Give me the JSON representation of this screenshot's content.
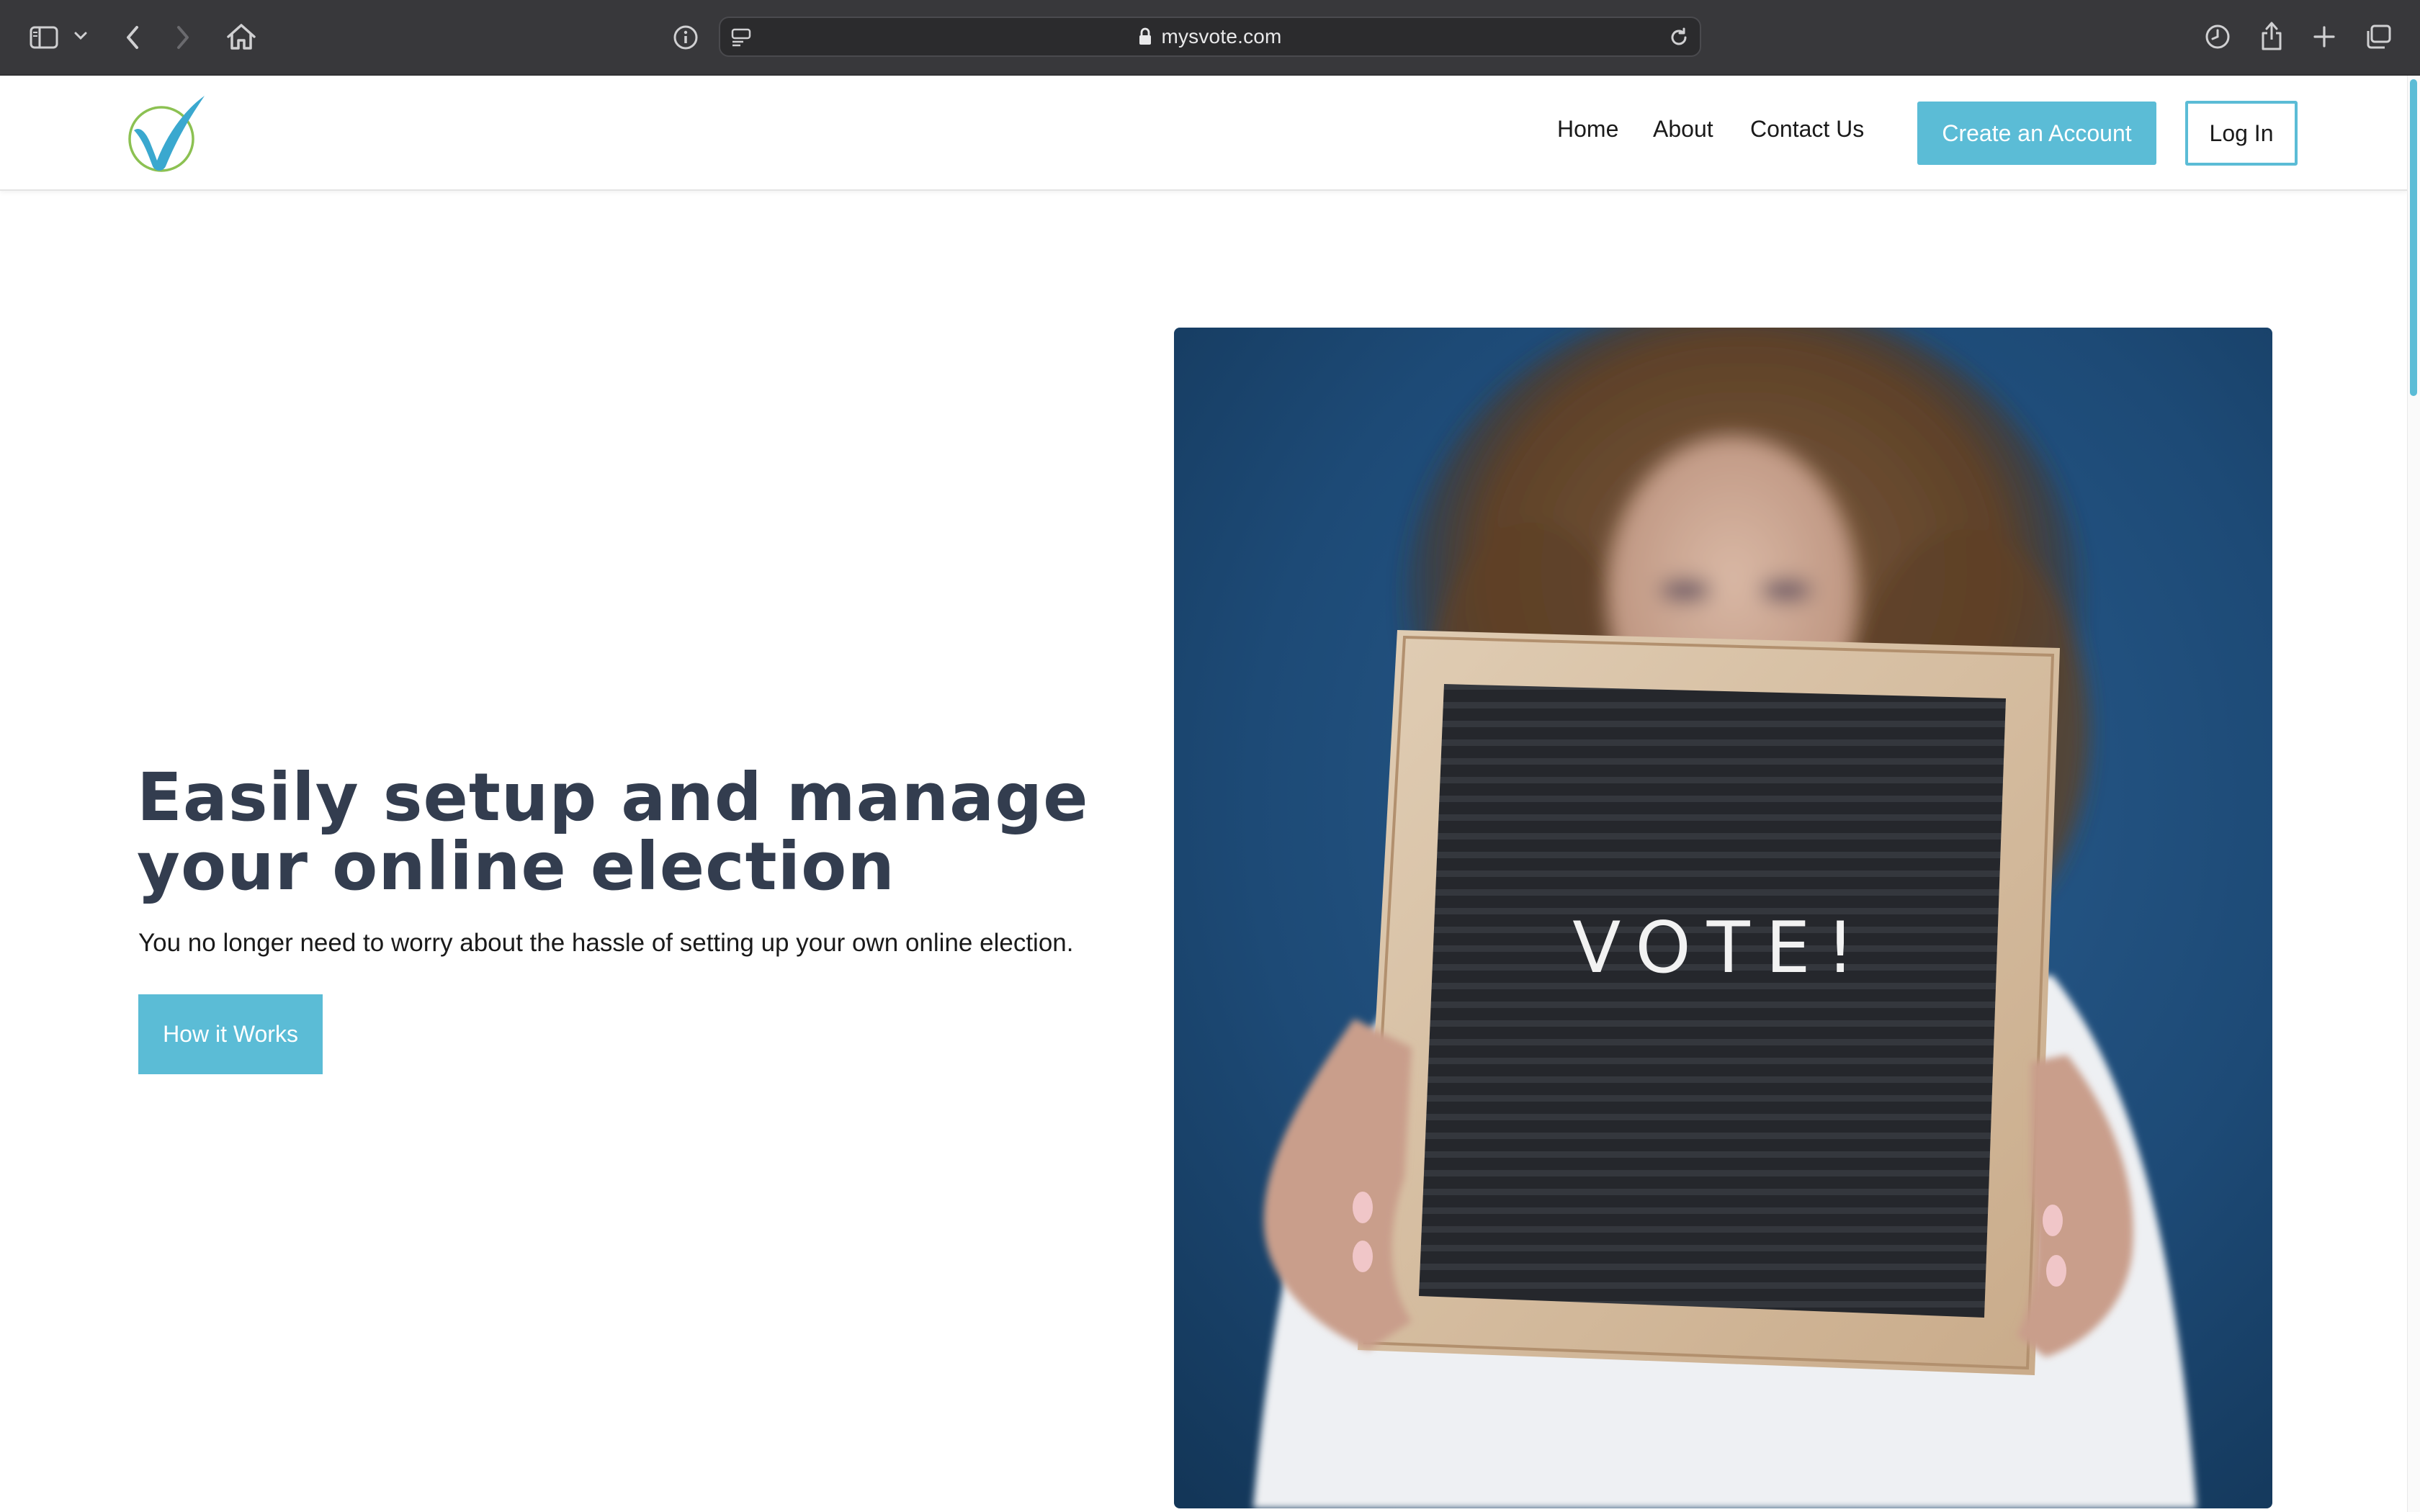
{
  "browser": {
    "url": "mysvote.com"
  },
  "nav": {
    "links": [
      "Home",
      "About",
      "Contact Us"
    ],
    "create_label": "Create an Account",
    "login_label": "Log In"
  },
  "hero": {
    "title": "Easily setup and manage your online election",
    "subtitle": "You no longer need to worry about the hassle of setting up your own online election.",
    "cta_label": "How it Works"
  },
  "photo": {
    "board_text": "VOTE!"
  },
  "colors": {
    "accent": "#5bbcd6",
    "heading": "#333d4f",
    "chrome": "#38383b",
    "photo_background": "#1d4a76",
    "logo_green": "#8cc152"
  },
  "icons": {
    "sidebar": "sidebar-toggle-icon",
    "back": "back-arrow-icon",
    "forward": "forward-arrow-icon",
    "home": "home-icon",
    "info": "info-icon",
    "reader": "reader-mode-icon",
    "lock": "lock-icon",
    "reload": "reload-icon",
    "history": "history-icon",
    "share": "share-icon",
    "new_tab": "plus-icon",
    "tabs": "tab-overview-icon",
    "logo": "checkmark-logo"
  }
}
